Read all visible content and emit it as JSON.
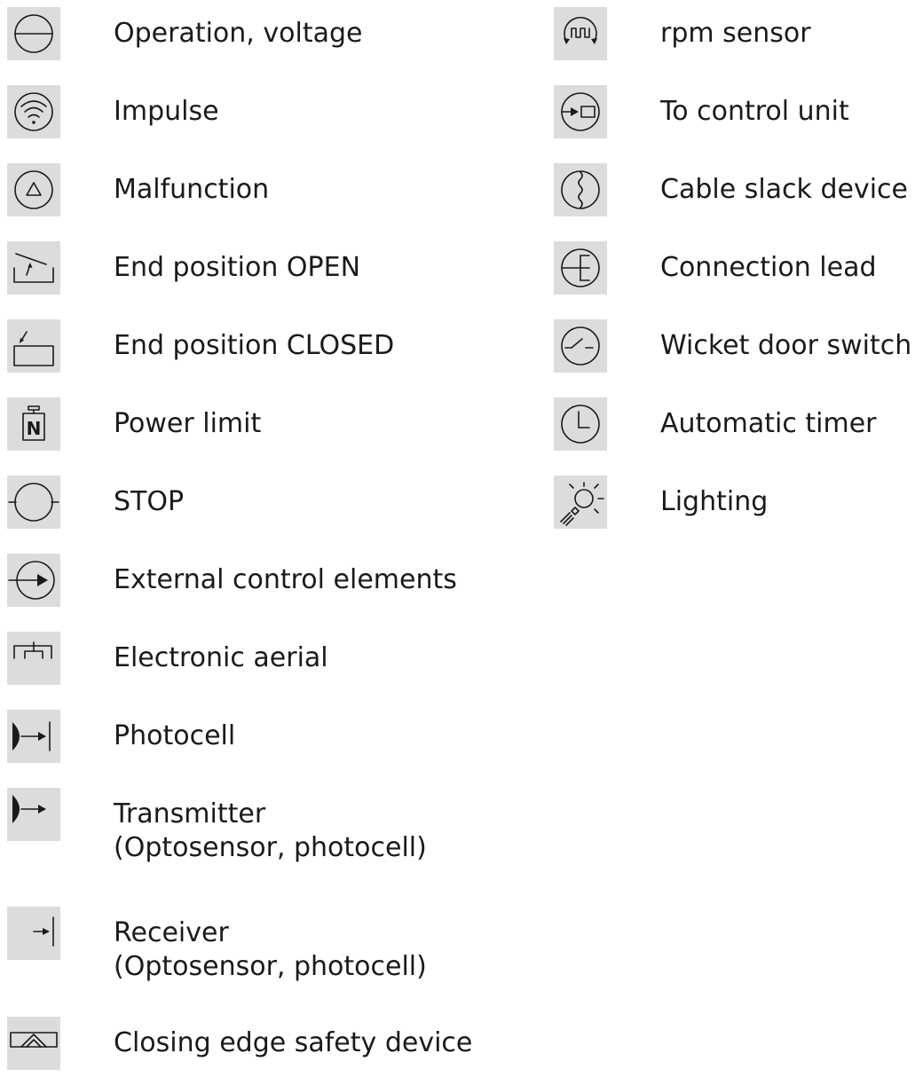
{
  "left_column": [
    {
      "label": "Operation, voltage"
    },
    {
      "label": "Impulse"
    },
    {
      "label": "Malfunction"
    },
    {
      "label": "End position OPEN"
    },
    {
      "label": "End position CLOSED"
    },
    {
      "label": "Power limit",
      "icon_text": "N"
    },
    {
      "label": "STOP"
    },
    {
      "label": "External control elements"
    },
    {
      "label": "Electronic aerial"
    },
    {
      "label": "Photocell"
    },
    {
      "label": "Transmitter",
      "label2": "(Optosensor, photocell)"
    },
    {
      "label": "Receiver",
      "label2": "(Optosensor, photocell)"
    },
    {
      "label": "Closing edge safety device"
    }
  ],
  "right_column": [
    {
      "label": "rpm sensor"
    },
    {
      "label": "To control unit"
    },
    {
      "label": "Cable slack device"
    },
    {
      "label": "Connection lead"
    },
    {
      "label": "Wicket door switch"
    },
    {
      "label": "Automatic timer"
    },
    {
      "label": "Lighting"
    }
  ],
  "icons": {
    "left": [
      "operation-voltage-icon",
      "impulse-icon",
      "malfunction-icon",
      "end-position-open-icon",
      "end-position-closed-icon",
      "power-limit-icon",
      "stop-icon",
      "external-control-elements-icon",
      "electronic-aerial-icon",
      "photocell-icon",
      "transmitter-icon",
      "receiver-icon",
      "closing-edge-safety-device-icon"
    ],
    "right": [
      "rpm-sensor-icon",
      "to-control-unit-icon",
      "cable-slack-device-icon",
      "connection-lead-icon",
      "wicket-door-switch-icon",
      "automatic-timer-icon",
      "lighting-icon"
    ]
  },
  "colors": {
    "icon_background": "#dcdcdc",
    "text": "#1a1a1a"
  }
}
